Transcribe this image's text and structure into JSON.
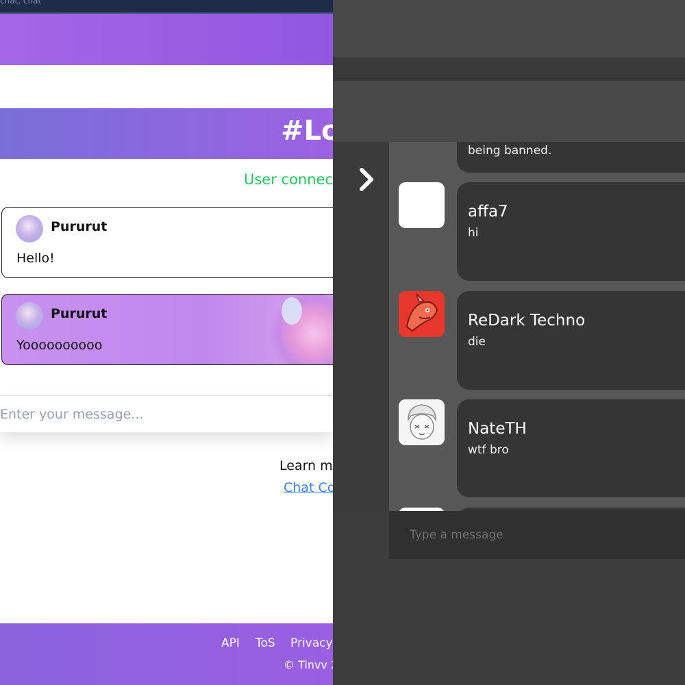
{
  "left_page": {
    "top_strip_text": "chat, chat",
    "room_title": "#Lo",
    "status_text": "User connec",
    "messages": [
      {
        "author": "Pururut",
        "text": "Hello!"
      },
      {
        "author": "Pururut",
        "text": "Yoooooooooo"
      }
    ],
    "input_placeholder": "Enter your message...",
    "learn_text": "Learn m",
    "learn_link": "Chat Co",
    "footer": {
      "links": [
        "API",
        "ToS",
        "Privacy"
      ],
      "copyright": "© Tinvv 2"
    }
  },
  "right_panel": {
    "partial_message": "being banned.",
    "messages": [
      {
        "name": "affa7",
        "text": "hi",
        "avatar": "blank-avatar"
      },
      {
        "name": "ReDark Techno",
        "text": "die",
        "avatar": "red-dragon-avatar"
      },
      {
        "name": "NateTH",
        "text": "wtf bro",
        "avatar": "sketch-character-avatar"
      }
    ],
    "input_placeholder": "Type a message",
    "toggle_icon": "chevron-right-icon"
  },
  "colors": {
    "accent_purple": "#9157e0",
    "status_green": "#22c55e",
    "link_blue": "#3b82f6",
    "dark_panel": "#3d3d3d",
    "dark_card": "#353535"
  }
}
